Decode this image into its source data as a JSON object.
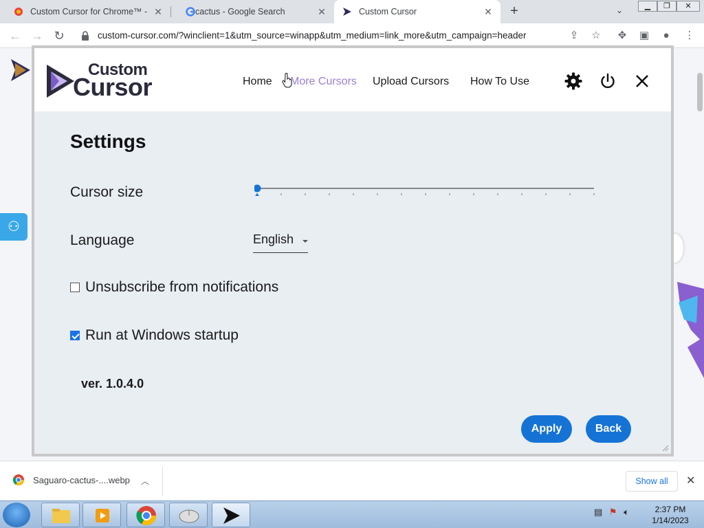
{
  "browser": {
    "tabs": [
      {
        "title": "Custom Cursor for Chrome™ - Cl",
        "active": false
      },
      {
        "title": "cactus - Google Search",
        "active": false
      },
      {
        "title": "Custom Cursor",
        "active": true
      }
    ],
    "url": "custom-cursor.com/?winclient=1&utm_source=winapp&utm_medium=link_more&utm_campaign=header"
  },
  "popup": {
    "logo_line1": "Custom",
    "logo_line2": "Cursor",
    "nav": [
      "Home",
      "More Cursors",
      "Upload Cursors",
      "How To Use"
    ],
    "title": "Settings",
    "cursor_size_label": "Cursor size",
    "cursor_size_value": 0,
    "language_label": "Language",
    "language_value": "English",
    "unsubscribe_label": "Unsubscribe from notifications",
    "unsubscribe_checked": false,
    "startup_label": "Run at Windows startup",
    "startup_checked": true,
    "version": "ver. 1.0.4.0",
    "apply_label": "Apply",
    "back_label": "Back"
  },
  "downloads": {
    "file": "Saguaro-cactus-....webp",
    "show_all": "Show all"
  },
  "taskbar": {
    "time": "2:37 PM",
    "date": "1/14/2023"
  },
  "colors": {
    "accent": "#1573d6",
    "hover_link": "#9b7fd4",
    "popup_bg": "#e9eef3"
  }
}
